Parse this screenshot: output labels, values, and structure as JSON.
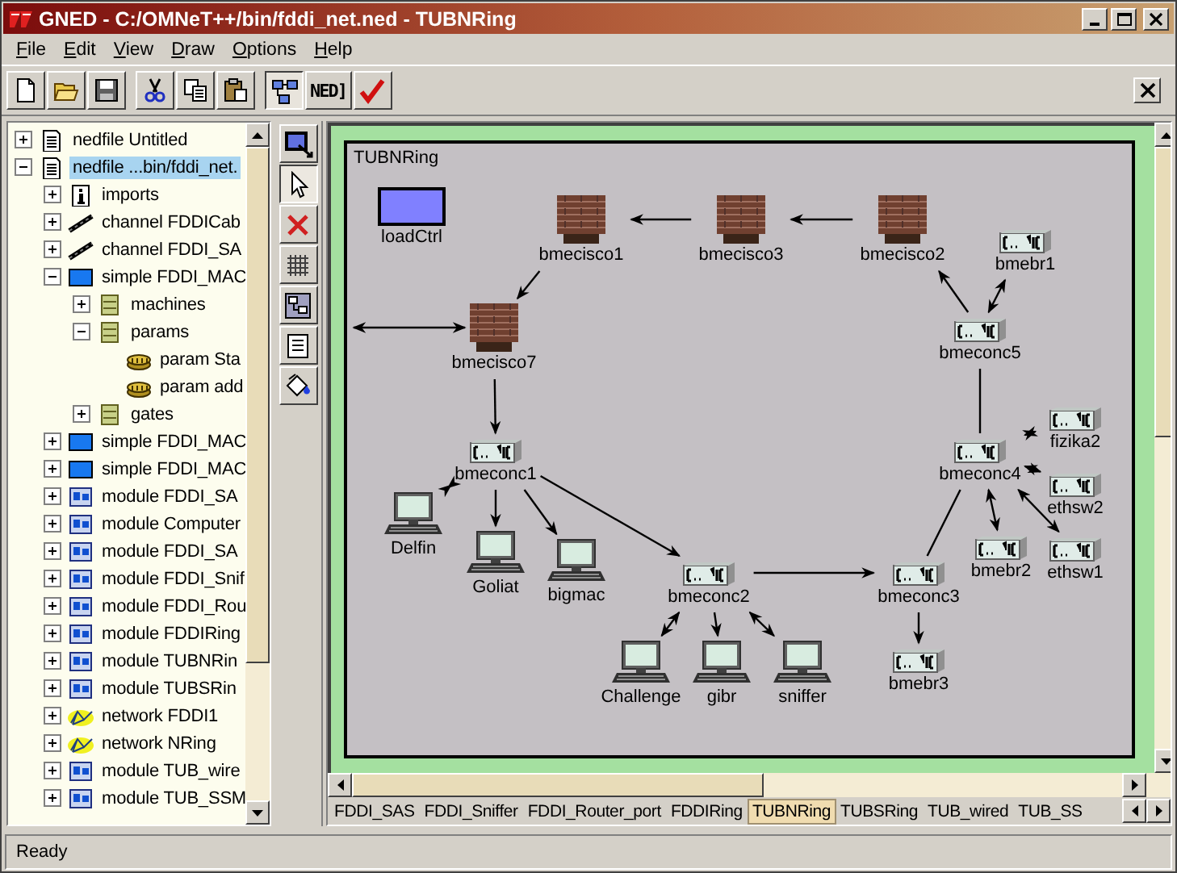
{
  "window": {
    "title": "GNED - C:/OMNeT++/bin/fddi_net.ned - TUBNRing"
  },
  "menu": [
    "File",
    "Edit",
    "View",
    "Draw",
    "Options",
    "Help"
  ],
  "toolbar": {
    "view_buttons": [
      {
        "pressed": true
      },
      {
        "pressed": false,
        "label": "NED]"
      }
    ]
  },
  "tree": [
    {
      "label": "nedfile Untitled",
      "kind": "file",
      "expanded": false,
      "selected": false
    },
    {
      "label": "nedfile ...bin/fddi_net.",
      "kind": "file",
      "expanded": true,
      "selected": true,
      "children": [
        {
          "label": "imports",
          "kind": "info",
          "expanded": false,
          "selected": false
        },
        {
          "label": "channel FDDICab",
          "kind": "channel",
          "expanded": false,
          "selected": false
        },
        {
          "label": "channel FDDI_SA",
          "kind": "channel",
          "expanded": false,
          "selected": false
        },
        {
          "label": "simple FDDI_MAC",
          "kind": "simple",
          "expanded": true,
          "selected": false,
          "children": [
            {
              "label": "machines",
              "kind": "section",
              "expanded": false,
              "selected": false
            },
            {
              "label": "params",
              "kind": "section",
              "expanded": true,
              "selected": false,
              "children": [
                {
                  "label": "param Sta",
                  "kind": "param",
                  "selected": false
                },
                {
                  "label": "param add",
                  "kind": "param",
                  "selected": false
                }
              ]
            },
            {
              "label": "gates",
              "kind": "section",
              "expanded": false,
              "selected": false
            }
          ]
        },
        {
          "label": "simple FDDI_MAC",
          "kind": "simple",
          "expanded": false,
          "selected": false
        },
        {
          "label": "simple FDDI_MAC",
          "kind": "simple",
          "expanded": false,
          "selected": false
        },
        {
          "label": "module FDDI_SA",
          "kind": "module",
          "expanded": false,
          "selected": false
        },
        {
          "label": "module Computer",
          "kind": "module",
          "expanded": false,
          "selected": false
        },
        {
          "label": "module FDDI_SA",
          "kind": "module",
          "expanded": false,
          "selected": false
        },
        {
          "label": "module FDDI_Snif",
          "kind": "module",
          "expanded": false,
          "selected": false
        },
        {
          "label": "module FDDI_Rou",
          "kind": "module",
          "expanded": false,
          "selected": false
        },
        {
          "label": "module FDDIRing",
          "kind": "module",
          "expanded": false,
          "selected": false
        },
        {
          "label": "module TUBNRin",
          "kind": "module",
          "expanded": false,
          "selected": false
        },
        {
          "label": "module TUBSRin",
          "kind": "module",
          "expanded": false,
          "selected": false
        },
        {
          "label": "network FDDI1",
          "kind": "network",
          "expanded": false,
          "selected": false
        },
        {
          "label": "network NRing",
          "kind": "network",
          "expanded": false,
          "selected": false
        },
        {
          "label": "module TUB_wire",
          "kind": "module",
          "expanded": false,
          "selected": false
        },
        {
          "label": "module TUB_SSM",
          "kind": "module",
          "expanded": false,
          "selected": false
        }
      ]
    }
  ],
  "tools": [
    {
      "pressed": false
    },
    {
      "pressed": true
    },
    {
      "pressed": false
    },
    {
      "pressed": false
    },
    {
      "pressed": false
    },
    {
      "pressed": false
    },
    {
      "pressed": false
    }
  ],
  "canvas": {
    "title": "TUBNRing",
    "nodes": [
      {
        "name": "loadCtrl",
        "kind": "module"
      },
      {
        "name": "bmecisco1",
        "kind": "router"
      },
      {
        "name": "bmecisco3",
        "kind": "router"
      },
      {
        "name": "bmecisco2",
        "kind": "router"
      },
      {
        "name": "bmebr1",
        "kind": "switch"
      },
      {
        "name": "bmecisco7",
        "kind": "router"
      },
      {
        "name": "bmeconc5",
        "kind": "switch"
      },
      {
        "name": "bmeconc1",
        "kind": "switch"
      },
      {
        "name": "fizika2",
        "kind": "switch"
      },
      {
        "name": "bmeconc4",
        "kind": "switch"
      },
      {
        "name": "ethsw2",
        "kind": "switch"
      },
      {
        "name": "Delfin",
        "kind": "computer"
      },
      {
        "name": "Goliat",
        "kind": "computer"
      },
      {
        "name": "bigmac",
        "kind": "computer"
      },
      {
        "name": "bmeconc2",
        "kind": "switch"
      },
      {
        "name": "bmeconc3",
        "kind": "switch"
      },
      {
        "name": "bmebr2",
        "kind": "switch"
      },
      {
        "name": "ethsw1",
        "kind": "switch"
      },
      {
        "name": "bmebr3",
        "kind": "switch"
      },
      {
        "name": "Challenge",
        "kind": "computer"
      },
      {
        "name": "gibr",
        "kind": "computer"
      },
      {
        "name": "sniffer",
        "kind": "computer"
      }
    ]
  },
  "tabs": [
    {
      "label": "FDDI_SAS",
      "selected": false
    },
    {
      "label": "FDDI_Sniffer",
      "selected": false
    },
    {
      "label": "FDDI_Router_port",
      "selected": false
    },
    {
      "label": "FDDIRing",
      "selected": false
    },
    {
      "label": "TUBNRing",
      "selected": true
    },
    {
      "label": "TUBSRing",
      "selected": false
    },
    {
      "label": "TUB_wired",
      "selected": false
    },
    {
      "label": "TUB_SS",
      "selected": false
    }
  ],
  "status_bar": "Ready"
}
